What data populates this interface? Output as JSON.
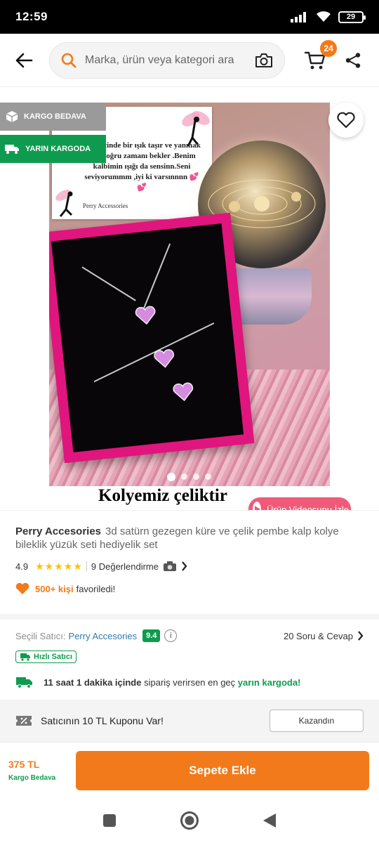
{
  "status_bar": {
    "time": "12:59",
    "battery": "29"
  },
  "header": {
    "search_placeholder": "Marka, ürün veya kategori ara",
    "cart_count": "24"
  },
  "gallery": {
    "badge_cargo": "KARGO BEDAVA",
    "badge_tomorrow": "YARIN KARGODA",
    "card_text": "Kalp içinde bir ışık taşır ve yanmak için doğru zamanı bekler .Benim kalbimin ışığı da sensinn.Seni seviyorummm ,iyi ki varsınnnn 💕💕",
    "card_brand": "Perry Accessories",
    "caption": "Kolyemiz çeliktir",
    "video_button": "Ürün Videosunu İzle",
    "dots": 4,
    "active_dot": 1
  },
  "product": {
    "brand": "Perry Accesories",
    "title": "3d  satürn gezegen küre ve çelik pembe kalp kolye bileklik yüzük seti hediyelik set",
    "rating": "4.9",
    "stars": 5,
    "review_count": "9 Değerlendirme",
    "favorite_count": "500+ kişi",
    "favorite_suffix": "favoriledi!"
  },
  "seller": {
    "label": "Seçili Satıcı:",
    "name": "Perry Accesories",
    "score": "9.4",
    "qa_link": "20 Soru & Cevap",
    "fast_badge": "Hızlı Satıcı",
    "delivery_time": "11 saat 1 dakika içinde",
    "delivery_middle": "sipariş verirsen en geç",
    "delivery_end": "yarın kargoda!"
  },
  "coupon": {
    "text": "Satıcının 10 TL Kuponu Var!",
    "button": "Kazandın"
  },
  "bottom": {
    "price": "375 TL",
    "free_cargo": "Kargo Bedava",
    "add_to_cart": "Sepete Ekle"
  },
  "colors": {
    "brand_orange": "#f27a1a",
    "green": "#0f9b4f",
    "link_blue": "#2e7bb0",
    "video_pink": "#f05a78"
  }
}
